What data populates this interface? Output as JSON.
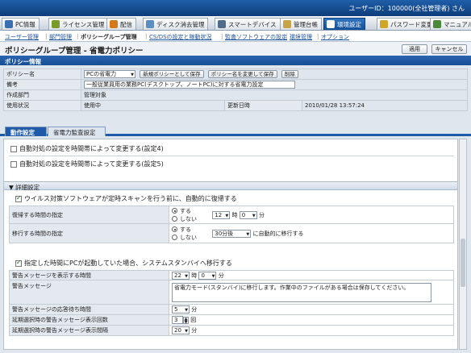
{
  "header": {
    "user": "ユーザーID：100000(全社管理者) さん"
  },
  "nav": [
    {
      "label": "PC情報",
      "icon": "computer-icon",
      "color": "#3a6fb0"
    },
    {
      "label": "ライセンス管理",
      "icon": "license-icon",
      "color": "#7a9a2a"
    },
    {
      "label": "配信",
      "icon": "distribution-icon",
      "color": "#d57a1a"
    },
    {
      "label": "ディスク消去管理",
      "icon": "disk-icon",
      "color": "#5b8fc4"
    },
    {
      "label": "スマートデバイス",
      "icon": "smartdevice-icon",
      "color": "#4f6b8a"
    },
    {
      "label": "管理台帳",
      "icon": "ledger-icon",
      "color": "#c9a34a"
    },
    {
      "label": "環境設定",
      "icon": "tools-icon",
      "color": "#ffffff"
    },
    {
      "label": "パスワード変更",
      "icon": "key-icon",
      "color": "#d1a525"
    },
    {
      "label": "マニュアル",
      "icon": "manual-icon",
      "color": "#4a8a3a"
    }
  ],
  "subnav": [
    "ユーザー管理",
    "部門管理",
    "ポリシーグループ管理",
    "CS/DSの設定と稼動状況",
    "監査ソフトウェアの設定",
    "環境管理",
    "オプション"
  ],
  "page": {
    "title": "ポリシーグループ管理 - 省電力ポリシー",
    "apply": "適用",
    "cancel": "キャンセル"
  },
  "policy_info": {
    "header": "ポリシー情報",
    "policy_name_label": "ポリシー名",
    "policy_name": "PCの省電力",
    "save_new": "新規ポリシーとして保存",
    "rename_save": "ポリシー名を変更して保存",
    "delete": "削除",
    "note_label": "備考",
    "note": "一般従業員用の業務PC(デスクトップ、ノートPC)に対する省電力設定",
    "dept_label": "作成部門",
    "dept": "管理対象",
    "status_label": "使用状況",
    "status": "使用中",
    "updated_label": "更新日時",
    "updated": "2010/01/28 13:57:24"
  },
  "tabs": [
    "動作設定",
    "省電力監査設定"
  ],
  "rows": {
    "time4": "自動対処の設定を時間帯によって変更する(設定4)",
    "time5": "自動対処の設定を時間帯によって変更する(設定5)",
    "detail_header": "▼ 詳細設定",
    "virus": "ウイルス対策ソフトウェアが定時スキャンを行う前に、自動的に復帰する",
    "resume_label": "復帰する時間の指定",
    "opt_yes": "する",
    "opt_no": "しない",
    "resume_hour": "12",
    "resume_hour_unit": "時",
    "resume_min": "0",
    "resume_min_unit": "分",
    "migrate_label": "移行する時間の指定",
    "migrate_sel": "30分後",
    "migrate_after": "に自動的に移行する",
    "standby": "指定した時間にPCが起動していた場合、システムスタンバイへ移行する",
    "warn_time_label": "警告メッセージを表示する時間",
    "warn_hour": "22",
    "warn_min": "0",
    "warn_msg_label": "警告メッセージ",
    "warn_msg": "省電力モード(スタンバイ)に移行します。作業中のファイルがある場合は保存してください。",
    "response_label": "警告メッセージの応答待ち時間",
    "response_val": "5",
    "response_unit": "分",
    "delay_count_label": "延期選択時の警告メッセージ表示回数",
    "delay_count": "3",
    "delay_count_unit": "回",
    "delay_interval_label": "延期選択時の警告メッセージ表示間隔",
    "delay_interval": "20",
    "delay_interval_unit": "分"
  }
}
